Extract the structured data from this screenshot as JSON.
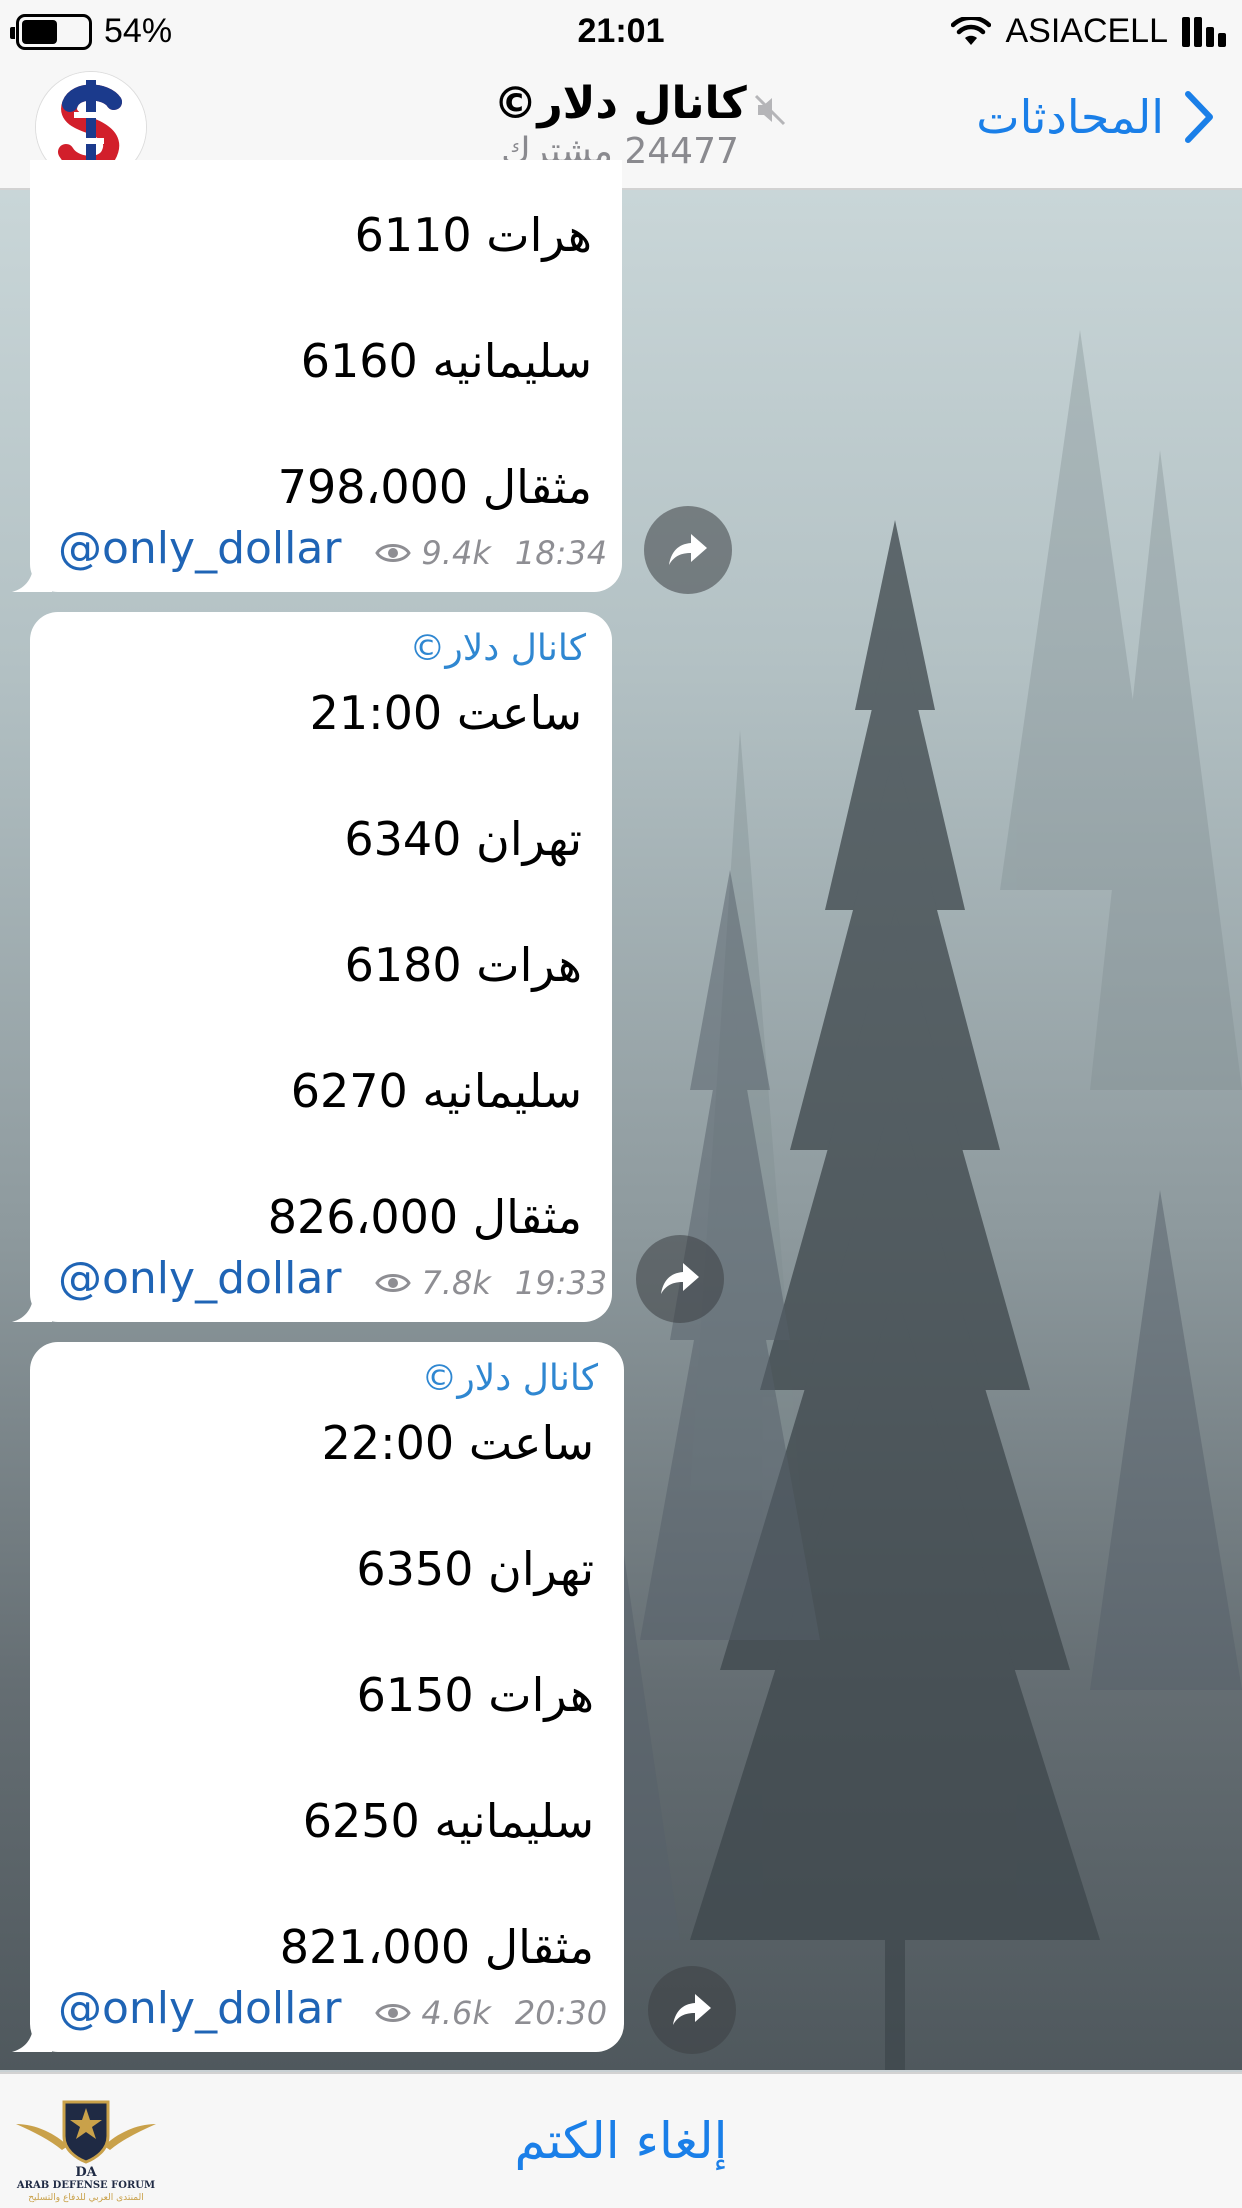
{
  "status_bar": {
    "battery_percent": "54%",
    "battery_level": 0.54,
    "time": "21:01",
    "carrier": "ASIACELL"
  },
  "nav": {
    "back_label": "المحادثات",
    "channel_title": "كانال دلار©",
    "subscribers": "24477 مشترك"
  },
  "messages": [
    {
      "author": "",
      "lines": [
        "هرات 6110",
        "سليمانيه 6160",
        "مثقال 798،000"
      ],
      "link": "@only_dollar",
      "views": "9.4k",
      "time": "18:34"
    },
    {
      "author": "كانال دلار©",
      "lines": [
        "ساعت 21:00",
        "تهران 6340",
        "هرات 6180",
        "سليمانيه 6270",
        "مثقال 826،000"
      ],
      "link": "@only_dollar",
      "views": "7.8k",
      "time": "19:33"
    },
    {
      "author": "كانال دلار©",
      "lines": [
        "ساعت 22:00",
        "تهران 6350",
        "هرات 6150",
        "سليمانيه 6250",
        "مثقال 821،000"
      ],
      "link": "@only_dollar",
      "views": "4.6k",
      "time": "20:30"
    }
  ],
  "bottom": {
    "unmute_label": "إلغاء الكتم"
  },
  "watermark": {
    "text_en": "ARAB DEFENSE FORUM",
    "text_ar": "المنتدى العربي للدفاع والتسليح",
    "monogram": "DA"
  },
  "colors": {
    "accent": "#1a7fe8",
    "author": "#2f87d1",
    "link": "#1f64b5",
    "meta": "#8e8e93"
  }
}
